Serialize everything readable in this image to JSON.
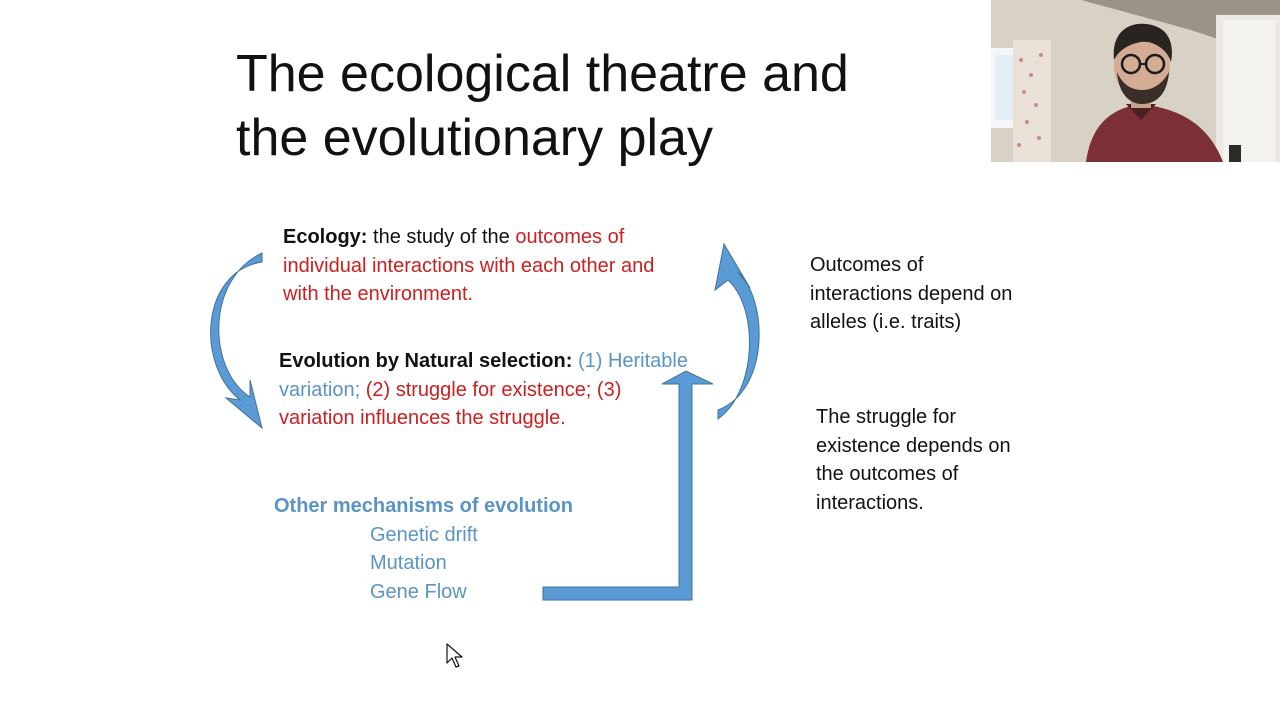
{
  "slide": {
    "title_line1": "The ecological theatre and",
    "title_line2": "the evolutionary play",
    "ecology": {
      "label": "Ecology:",
      "plain": " the study of the ",
      "red_line1": "outcomes of",
      "red_line2": "individual interactions with each other and",
      "red_line3": "with the environment."
    },
    "evolution": {
      "label": "Evolution by Natural selection:",
      "blue1": " (1) Heritable",
      "blue2": "variation;",
      "red1": " (2) struggle for existence; (3)",
      "red2": "variation influences the struggle."
    },
    "other_mechanisms": {
      "heading": "Other mechanisms of evolution",
      "items": [
        "Genetic drift",
        "Mutation",
        "Gene Flow"
      ]
    },
    "notes": {
      "alleles_line1": "Outcomes of",
      "alleles_line2": "interactions depend on",
      "alleles_line3": "alleles (i.e. traits)",
      "struggle_line1": "The struggle for",
      "struggle_line2": "existence depends on",
      "struggle_line3": "the outcomes of",
      "struggle_line4": "interactions."
    }
  },
  "colors": {
    "red_text": "#cc1f1f",
    "blue_text": "#5a94c6",
    "arrow_fill": "#5b9bd5",
    "arrow_stroke": "#41719c"
  },
  "icons": {
    "cursor": "mouse-pointer-icon"
  }
}
